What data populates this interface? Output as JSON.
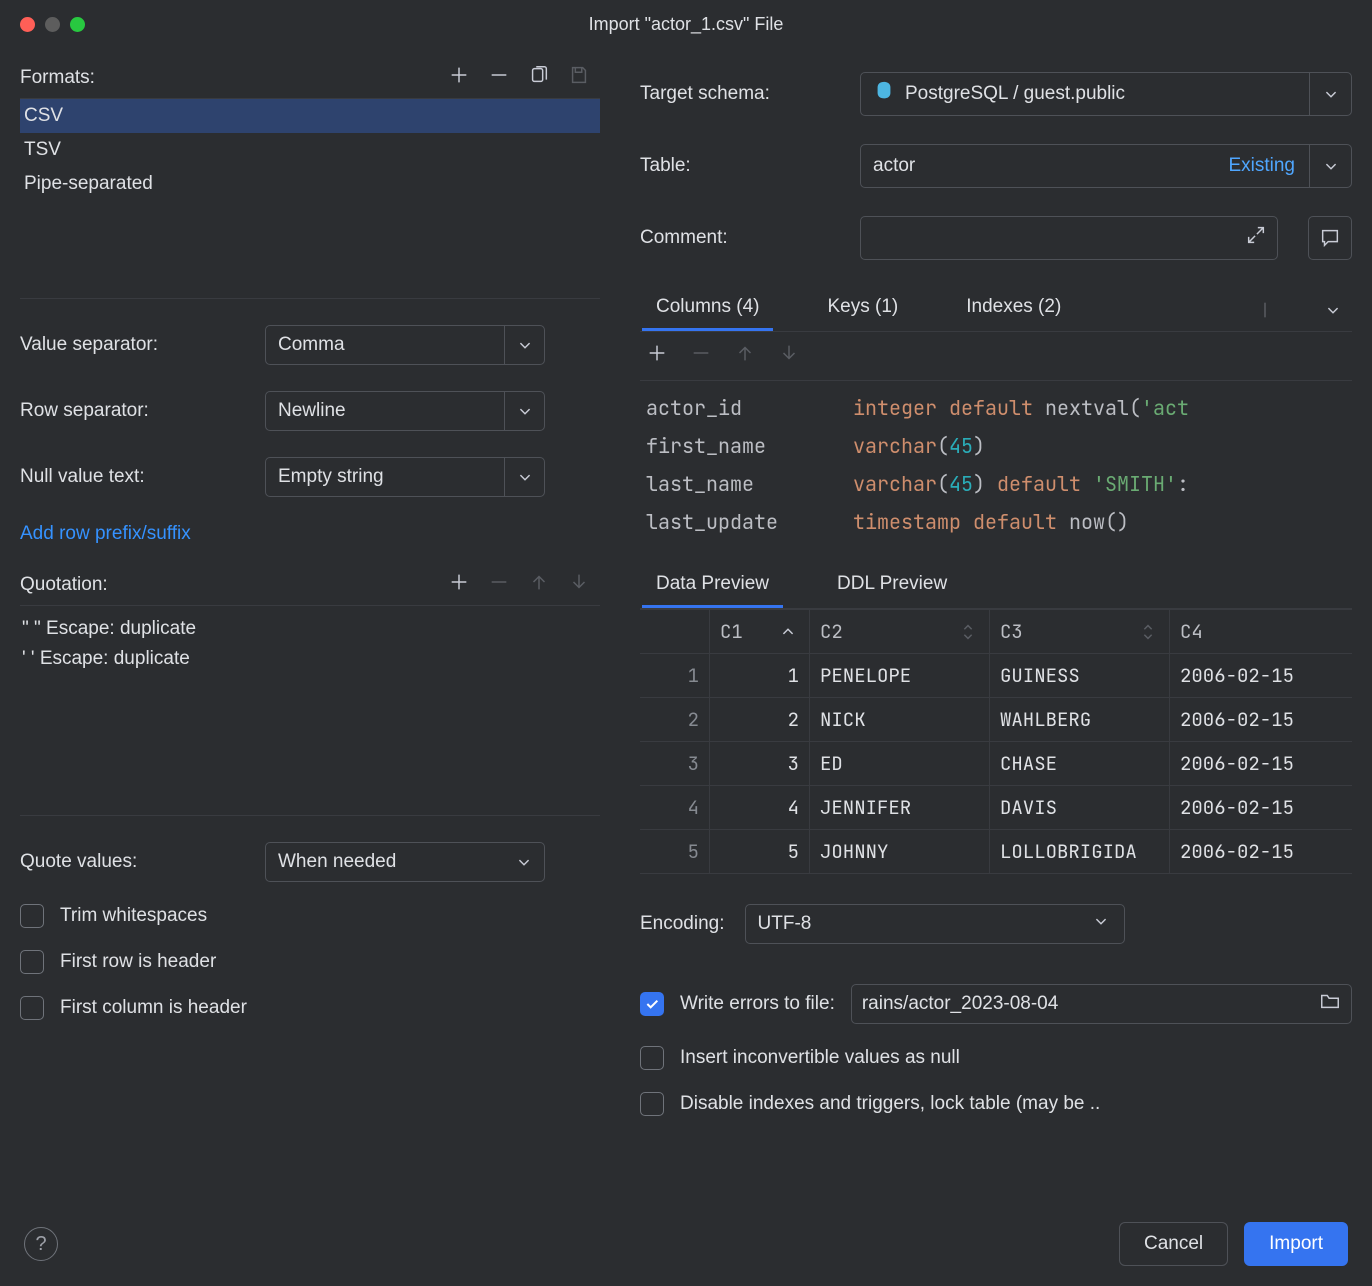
{
  "window": {
    "title": "Import \"actor_1.csv\" File",
    "traffic": {
      "close": "#ff5f57",
      "min": "#5d5d5d",
      "max": "#28c840"
    }
  },
  "left": {
    "formats_label": "Formats:",
    "formats": [
      "CSV",
      "TSV",
      "Pipe-separated"
    ],
    "value_separator_label": "Value separator:",
    "value_separator": "Comma",
    "row_separator_label": "Row separator:",
    "row_separator": "Newline",
    "null_text_label": "Null value text:",
    "null_text": "Empty string",
    "add_prefix_link": "Add row prefix/suffix",
    "quotation_label": "Quotation:",
    "quotation_items": [
      "\"  \"  Escape: duplicate",
      "'  '  Escape: duplicate"
    ],
    "quote_values_label": "Quote values:",
    "quote_values": "When needed",
    "chk_trim": "Trim whitespaces",
    "chk_first_row": "First row is header",
    "chk_first_col": "First column is header"
  },
  "right": {
    "target_schema_label": "Target schema:",
    "target_schema": "PostgreSQL / guest.public",
    "table_label": "Table:",
    "table": "actor",
    "table_existing": "Existing",
    "comment_label": "Comment:",
    "tabs": {
      "columns": "Columns (4)",
      "keys": "Keys (1)",
      "indexes": "Indexes (2)"
    },
    "columns": [
      {
        "name": "actor_id",
        "type": "integer",
        "extra_kw": "default",
        "extra_fn": "nextval",
        "extra_paren_str": "'act"
      },
      {
        "name": "first_name",
        "type": "varchar",
        "size": 45
      },
      {
        "name": "last_name",
        "type": "varchar",
        "size": 45,
        "extra_kw": "default",
        "extra_str": "'SMITH'",
        "extra_suffix": ":"
      },
      {
        "name": "last_update",
        "type": "timestamp",
        "extra_kw": "default",
        "extra_fn": "now",
        "extra_paren": "()"
      }
    ],
    "preview_tabs": {
      "data": "Data Preview",
      "ddl": "DDL Preview"
    },
    "preview_headers": [
      "C1",
      "C2",
      "C3",
      "C4"
    ],
    "preview_rows": [
      {
        "n": 1,
        "c1": 1,
        "c2": "PENELOPE",
        "c3": "GUINESS",
        "c4": "2006-02-15"
      },
      {
        "n": 2,
        "c1": 2,
        "c2": "NICK",
        "c3": "WAHLBERG",
        "c4": "2006-02-15"
      },
      {
        "n": 3,
        "c1": 3,
        "c2": "ED",
        "c3": "CHASE",
        "c4": "2006-02-15"
      },
      {
        "n": 4,
        "c1": 4,
        "c2": "JENNIFER",
        "c3": "DAVIS",
        "c4": "2006-02-15"
      },
      {
        "n": 5,
        "c1": 5,
        "c2": "JOHNNY",
        "c3": "LOLLOBRIGIDA",
        "c4": "2006-02-15"
      }
    ],
    "encoding_label": "Encoding:",
    "encoding": "UTF-8",
    "write_errors_label": "Write errors to file:",
    "write_errors_file": "rains/actor_2023-08-04",
    "chk_insert_null": "Insert inconvertible values as null",
    "chk_disable_idx": "Disable indexes and triggers, lock table (may be .."
  },
  "footer": {
    "cancel": "Cancel",
    "import": "Import"
  }
}
